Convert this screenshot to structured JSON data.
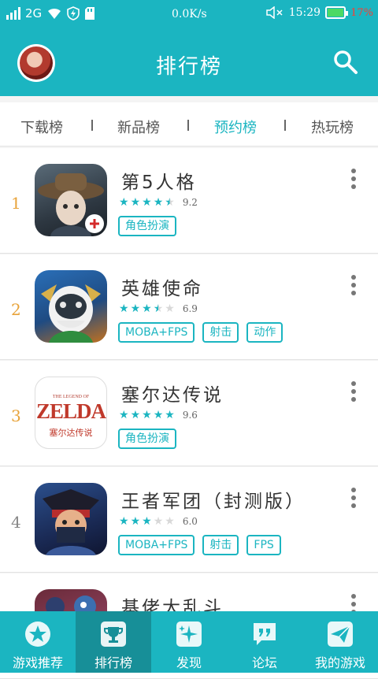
{
  "status_bar": {
    "network": "2G",
    "speed": "0.0K/s",
    "time": "15:29",
    "battery": "17%",
    "battery_level": 0.17
  },
  "app_bar": {
    "title": "排行榜"
  },
  "tabs": [
    {
      "label": "下载榜",
      "active": false
    },
    {
      "label": "新品榜",
      "active": false
    },
    {
      "label": "预约榜",
      "active": true
    },
    {
      "label": "热玩榜",
      "active": false
    }
  ],
  "games": [
    {
      "rank": "1",
      "name": "第5人格",
      "rating": 4.6,
      "score": "9.2",
      "tags": [
        "角色扮演"
      ]
    },
    {
      "rank": "2",
      "name": "英雄使命",
      "rating": 3.5,
      "score": "6.9",
      "tags": [
        "MOBA+FPS",
        "射击",
        "动作"
      ]
    },
    {
      "rank": "3",
      "name": "塞尔达传说",
      "rating": 4.8,
      "score": "9.6",
      "tags": [
        "角色扮演"
      ],
      "icon_text": [
        "ZELDA",
        "塞尔达传说",
        "THE LEGEND OF"
      ]
    },
    {
      "rank": "4",
      "name": "王者军团（封测版）",
      "rating": 3.0,
      "score": "6.0",
      "tags": [
        "MOBA+FPS",
        "射击",
        "FPS"
      ]
    },
    {
      "rank": "",
      "name": "基佬大乱斗",
      "rating": 0,
      "score": "",
      "tags": []
    }
  ],
  "bottom_nav": [
    {
      "label": "游戏推荐",
      "icon": "star-icon",
      "active": false
    },
    {
      "label": "排行榜",
      "icon": "trophy-icon",
      "active": true
    },
    {
      "label": "发现",
      "icon": "sparkle-icon",
      "active": false
    },
    {
      "label": "论坛",
      "icon": "chat-quote-icon",
      "active": false
    },
    {
      "label": "我的游戏",
      "icon": "paper-plane-icon",
      "active": false
    }
  ],
  "colors": {
    "accent": "#1bb5c1",
    "rank_top": "#e8a33a",
    "battery_text": "#ff3b30"
  }
}
